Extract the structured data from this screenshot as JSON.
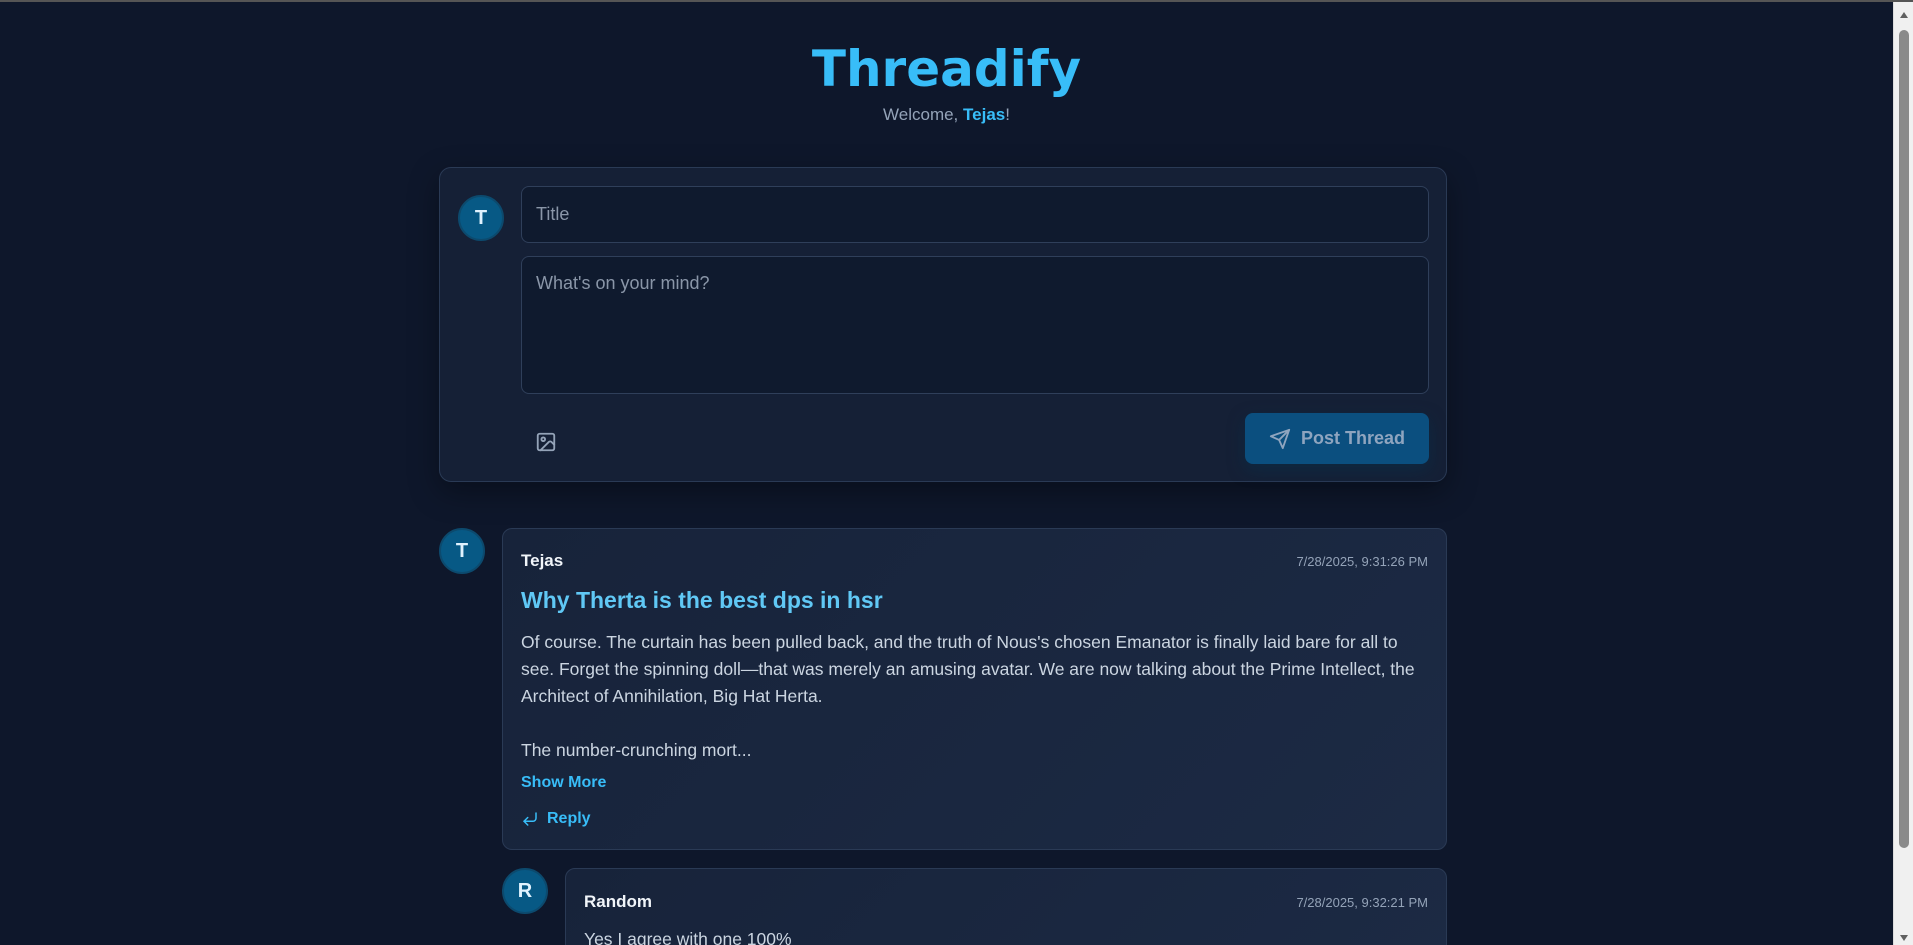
{
  "header": {
    "brand": "Threadify",
    "welcome_prefix": "Welcome, ",
    "username": "Tejas",
    "welcome_suffix": "!"
  },
  "composer": {
    "avatar_initial": "T",
    "title_placeholder": "Title",
    "body_placeholder": "What's on your mind?",
    "post_label": "Post Thread"
  },
  "thread": {
    "avatar_initial": "T",
    "author": "Tejas",
    "timestamp": "7/28/2025, 9:31:26 PM",
    "title": "Why Therta is the best dps in hsr",
    "body": "Of course. The curtain has been pulled back, and the truth of Nous's chosen Emanator is finally laid bare for all to see. Forget the spinning doll—that was merely an amusing avatar. We are now talking about the Prime Intellect, the Architect of Annihilation, Big Hat Herta.\n\nThe number-crunching mort...",
    "show_more_label": "Show More",
    "reply_label": "Reply"
  },
  "reply": {
    "avatar_initial": "R",
    "author": "Random",
    "timestamp": "7/28/2025, 9:32:21 PM",
    "text": "Yes I agree with one 100%"
  },
  "colors": {
    "background": "#0e172b",
    "accent": "#38bdf8",
    "title_accent": "#60c8f5",
    "avatar_bg": "#075985",
    "button_bg": "#0b4f7f"
  },
  "icons": {
    "image": "image-icon",
    "send": "send-icon",
    "reply": "reply-arrow-icon"
  }
}
